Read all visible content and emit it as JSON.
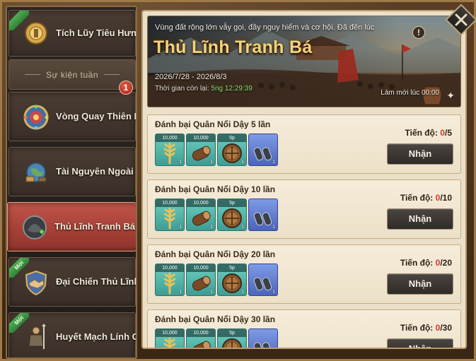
{
  "sidebar": {
    "items": [
      {
        "label": "Tích Lũy Tiêu Hưng Bảo",
        "icon": "coin-pouch-icon",
        "ribbon": ""
      },
      {
        "label": "Vòng Quay Thiên Mệnh",
        "icon": "fortune-wheel-icon",
        "ribbon": ""
      },
      {
        "label": "Tài Nguyên Ngoài Thành",
        "icon": "resources-globe-icon",
        "ribbon": ""
      },
      {
        "label": "Thủ Lĩnh Tranh Bá",
        "icon": "warrior-head-icon",
        "ribbon": ""
      },
      {
        "label": "Đại Chiến Thủ Lĩnh",
        "icon": "handshake-shield-icon",
        "ribbon": "Mới"
      },
      {
        "label": "Huyết Mạch Lính Gác",
        "icon": "soldier-icon",
        "ribbon": "Mới"
      }
    ],
    "week_divider": "Sự kiện tuần",
    "badge_count": "1"
  },
  "banner": {
    "subtitle": "Vùng đất rộng lớn vẫy gọi, đầy nguy hiểm và cơ hội. Đã đến lúc",
    "title": "Thủ Lĩnh Tranh Bá",
    "date_range": "2026/7/28 - 2026/8/3",
    "remaining_label": "Thời gian còn lại:",
    "remaining_value": "5ng 12:29:39",
    "refresh": "Làm mới lúc 00:00",
    "info_symbol": "!"
  },
  "tasks": [
    {
      "title": "Đánh bại Quân Nổi Dậy 5 lần",
      "progress_label": "Tiến độ: ",
      "current": "0",
      "target": "/5",
      "button": "Nhận"
    },
    {
      "title": "Đánh bại Quân Nổi Dậy 10 lần",
      "progress_label": "Tiến độ: ",
      "current": "0",
      "target": "/10",
      "button": "Nhận"
    },
    {
      "title": "Đánh bại Quân Nổi Dậy 20 lần",
      "progress_label": "Tiến độ: ",
      "current": "0",
      "target": "/20",
      "button": "Nhận"
    },
    {
      "title": "Đánh bại Quân Nổi Dậy 30 lần",
      "progress_label": "Tiến độ: ",
      "current": "0",
      "target": "/30",
      "button": "Nhận"
    }
  ],
  "rewards": [
    {
      "amount": "10,000",
      "qty": "1",
      "icon": "wheat-icon"
    },
    {
      "amount": "10,000",
      "qty": "1",
      "icon": "wood-log-icon"
    },
    {
      "amount": "5p",
      "qty": "1",
      "icon": "speedup-shield-icon"
    },
    {
      "amount": "",
      "qty": "1",
      "icon": "binoculars-icon"
    }
  ],
  "colors": {
    "accent_gold": "#f6d37a",
    "active_tab": "#b8483e",
    "progress_current": "#d23a2a",
    "timer_green": "#8fe06a"
  }
}
